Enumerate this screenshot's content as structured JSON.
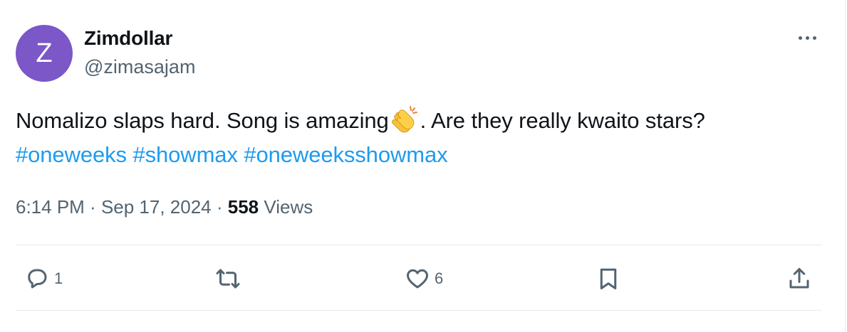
{
  "author": {
    "avatar_letter": "Z",
    "avatar_color": "#7b57c8",
    "display_name": "Zimdollar",
    "handle": "@zimasajam"
  },
  "tweet": {
    "text_before_emoji": "Nomalizo slaps hard. Song is amazing",
    "emoji": "clapping-hands",
    "text_after_emoji": ". Are they really kwaito stars?",
    "hashtags": [
      "#oneweeks",
      "#showmax",
      "#oneweeksshowmax"
    ]
  },
  "meta": {
    "time": "6:14 PM",
    "separator": " · ",
    "date": "Sep 17, 2024",
    "views_count": "558",
    "views_label": " Views"
  },
  "actions": {
    "reply_count": "1",
    "retweet_count": "",
    "like_count": "6"
  },
  "colors": {
    "text": "#0f1419",
    "secondary": "#536471",
    "link": "#1d9bf0",
    "divider": "#e7e9ea"
  },
  "icons": [
    "more-icon",
    "reply-icon",
    "retweet-icon",
    "like-icon",
    "bookmark-icon",
    "share-icon",
    "clapping-hands-emoji"
  ]
}
